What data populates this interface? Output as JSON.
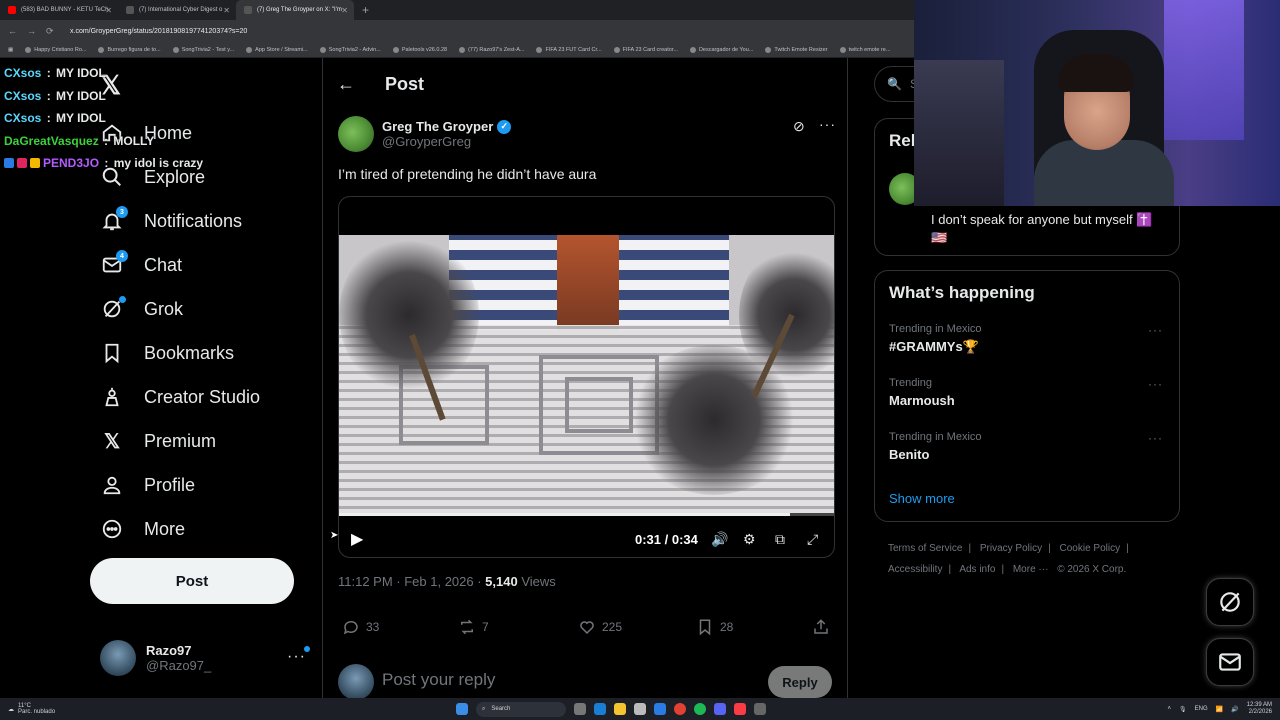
{
  "browser": {
    "tabs": [
      {
        "label": "(583) BAD BUNNY - KETU TeCh",
        "color": "#ff0000"
      },
      {
        "label": "(7) International Cyber Digest o",
        "color": "#e7e9ea"
      },
      {
        "label": "(7) Greg The Groyper on X: \"I'm",
        "color": "#e7e9ea"
      }
    ],
    "new_tab": "+",
    "url": "x.com/GroyperGreg/status/2018190819774120374?s=20",
    "bookmarks": [
      "Happy Cristiano Ro...",
      "Burrego figura de to...",
      "SongTrivia2 - Test y...",
      "App Store / Streami...",
      "SongTrivia2 - Advin...",
      "Paletools v26.0.28",
      "(77) Razo97's Zest-A...",
      "FIFA 23 FUT Card Cr...",
      "FIFA 23 Card creator...",
      "Descargador de You...",
      "Twitch Emote Resizer",
      "twitch emote re..."
    ]
  },
  "chat": [
    {
      "user": "CXsos",
      "color": "#5ad7ff",
      "message": "MY IDOL"
    },
    {
      "user": "CXsos",
      "color": "#5ad7ff",
      "message": "MY IDOL"
    },
    {
      "user": "CXsos",
      "color": "#5ad7ff",
      "message": "MY IDOL"
    },
    {
      "user": "DaGreatVasquez",
      "color": "#3bd23b",
      "message": "MOLLY"
    },
    {
      "user": "PEND3JO",
      "color": "#b25cff",
      "message": "my idol is crazy"
    }
  ],
  "nav": {
    "home": "Home",
    "explore": "Explore",
    "notifications": "Notifications",
    "notifications_badge": "3",
    "chat": "Chat",
    "chat_badge": "4",
    "grok": "Grok",
    "bookmarks": "Bookmarks",
    "creator_studio": "Creator Studio",
    "premium": "Premium",
    "profile": "Profile",
    "more": "More",
    "post_button": "Post"
  },
  "account": {
    "name": "Razo97",
    "handle": "@Razo97_"
  },
  "post": {
    "header_title": "Post",
    "author_name": "Greg The Groyper",
    "author_handle": "@GroyperGreg",
    "text": "I’m tired of pretending he didn’t have aura",
    "video": {
      "current": "0:31",
      "duration": "0:34",
      "separator": " / ",
      "progress": 0.912
    },
    "time": "11:12 PM · Feb 1, 2026 · ",
    "views_count": "5,140",
    "views_label": " Views",
    "replies": "33",
    "reposts": "7",
    "likes": "225",
    "bookmarks": "28",
    "reply_placeholder": "Post your reply",
    "reply_button": "Reply"
  },
  "right": {
    "search_placeholder": "Se",
    "relevant_title": "Rel",
    "bio": "I don’t speak for anyone but myself ✝️ 🇺🇸",
    "happening_title": "What’s happening",
    "trends": [
      {
        "context": "Trending in Mexico",
        "name": "#GRAMMYs🏆"
      },
      {
        "context": "Trending",
        "name": "Marmoush"
      },
      {
        "context": "Trending in Mexico",
        "name": "Benito"
      }
    ],
    "show_more": "Show more",
    "footer": [
      "Terms of Service",
      "|",
      "Privacy Policy",
      "|",
      "Cookie Policy",
      "|",
      "Accessibility",
      "|",
      "Ads info",
      "|",
      "More ···",
      "© 2026 X Corp."
    ]
  },
  "taskbar": {
    "weather_temp": "11°C",
    "weather_desc": "Parc. nublado",
    "search": "Search",
    "lang": "ENG",
    "clock_time": "12:39 AM",
    "clock_date": "2/2/2026"
  },
  "colors": {
    "accent": "#1d9bf0",
    "background": "#000000",
    "text": "#e7e9ea",
    "muted": "#71767b"
  }
}
